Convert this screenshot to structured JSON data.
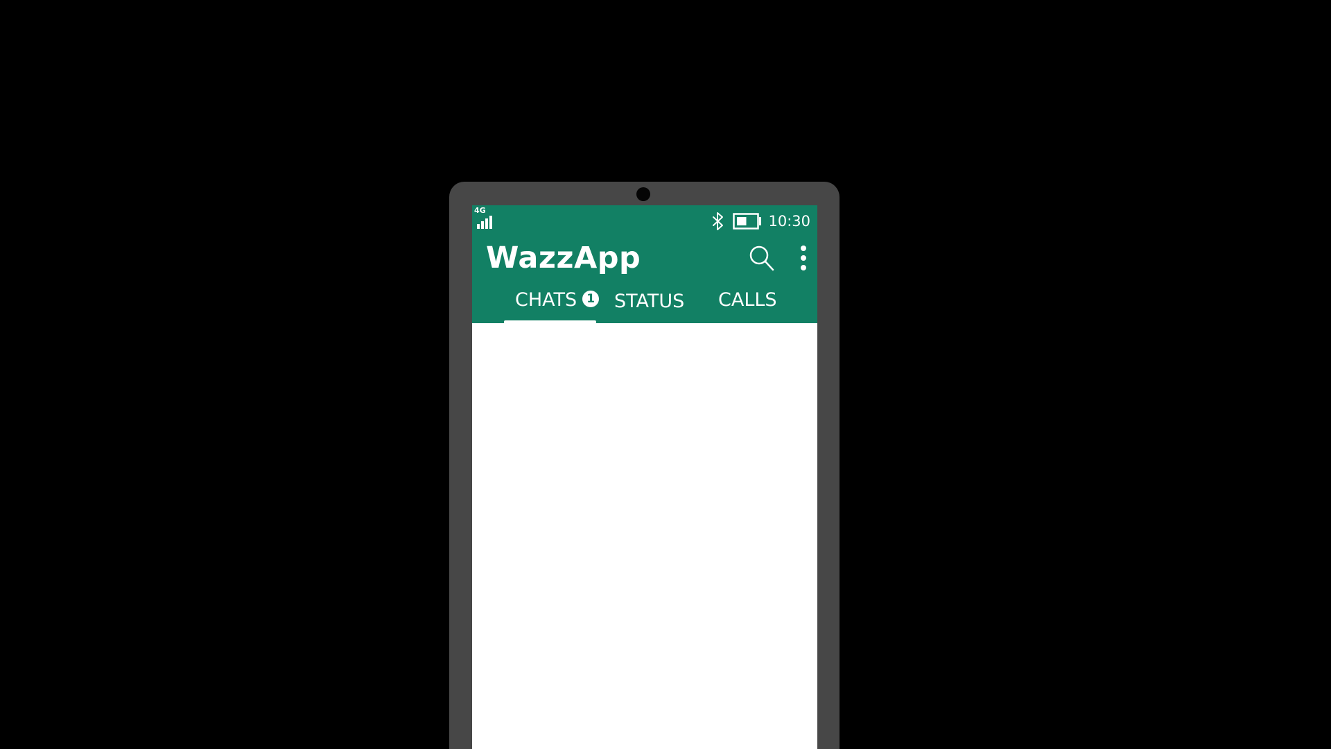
{
  "app": {
    "title": "WazzApp",
    "brand_color": "#128064"
  },
  "status_bar": {
    "network": "4G",
    "signal_icon": "signal-bars-icon",
    "bluetooth_icon": "bluetooth-icon",
    "battery_icon": "battery-icon",
    "battery_level": 0.5,
    "time": "10:30"
  },
  "toolbar": {
    "search_icon": "search-icon",
    "menu_icon": "more-vert-icon"
  },
  "tabs": [
    {
      "label": "CHATS",
      "badge": "1",
      "selected": true
    },
    {
      "label": "STATUS",
      "selected": false
    },
    {
      "label": "CALLS",
      "selected": false
    }
  ],
  "device": {
    "frame_color": "#474747",
    "background": "#000000"
  }
}
